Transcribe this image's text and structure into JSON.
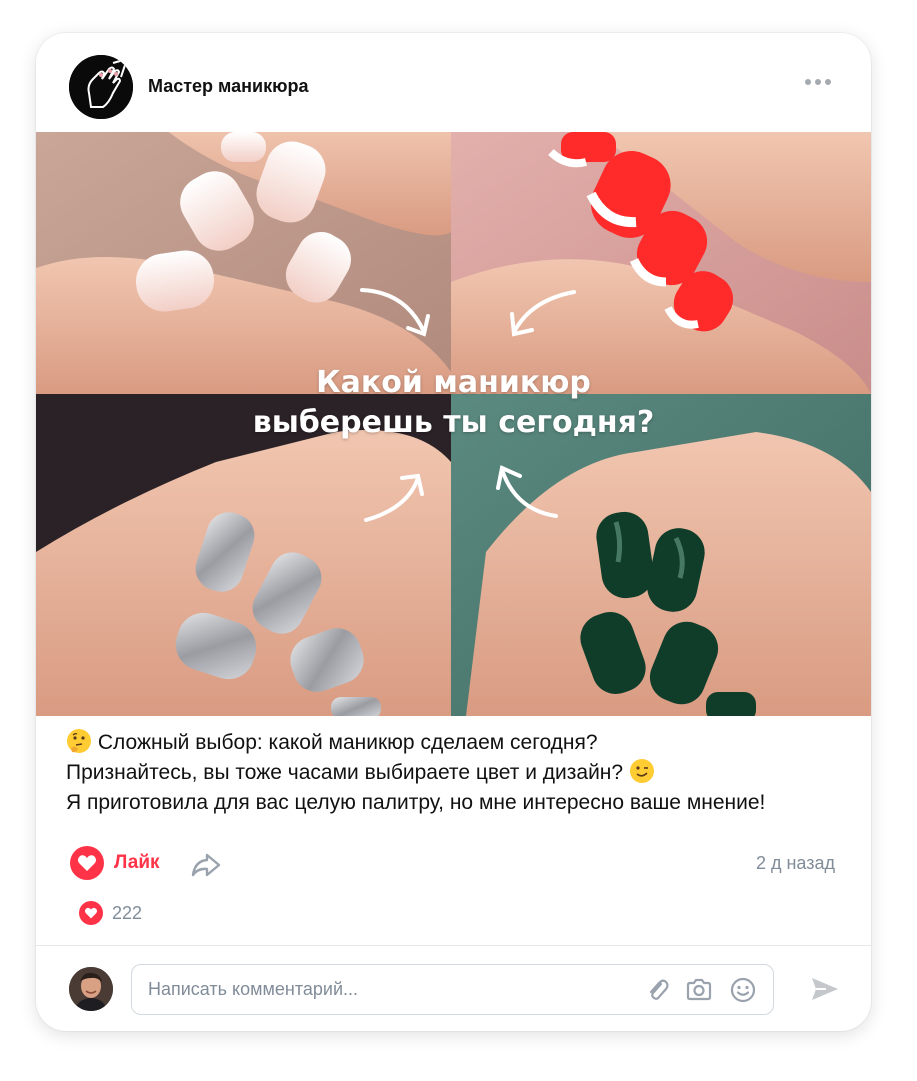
{
  "post": {
    "author": "Мастер маникюра",
    "image_title_line1": "Какой маникюр",
    "image_title_line2": "выберешь ты сегодня?",
    "text_line1": "Сложный выбор: какой маникюр сделаем сегодня?",
    "text_line2": "Признайтесь, вы тоже часами выбираете цвет и дизайн?",
    "text_line3": "Я приготовила для вас целую палитру, но мне интересно ваше мнение!",
    "emoji_line1": "thinking-face-emoji",
    "emoji_line2": "winking-face-emoji",
    "timestamp": "2 д назад",
    "likes": "222"
  },
  "actions": {
    "like_label": "Лайк",
    "like_icon": "heart-icon",
    "share_icon": "share-icon",
    "more_icon": "more-dots-icon"
  },
  "comment": {
    "placeholder": "Написать комментарий...",
    "attach_icon": "paperclip-icon",
    "camera_icon": "camera-icon",
    "emoji_icon": "smile-icon",
    "send_icon": "send-icon"
  },
  "colors": {
    "accent": "#ff3347",
    "secondary_text": "#818c99",
    "border": "#d3d9de",
    "nude_bg": "#c8a89a",
    "red_bg": "#d99a9a",
    "glitter_bg": "#2a2226",
    "green_bg": "#4f7d73"
  }
}
